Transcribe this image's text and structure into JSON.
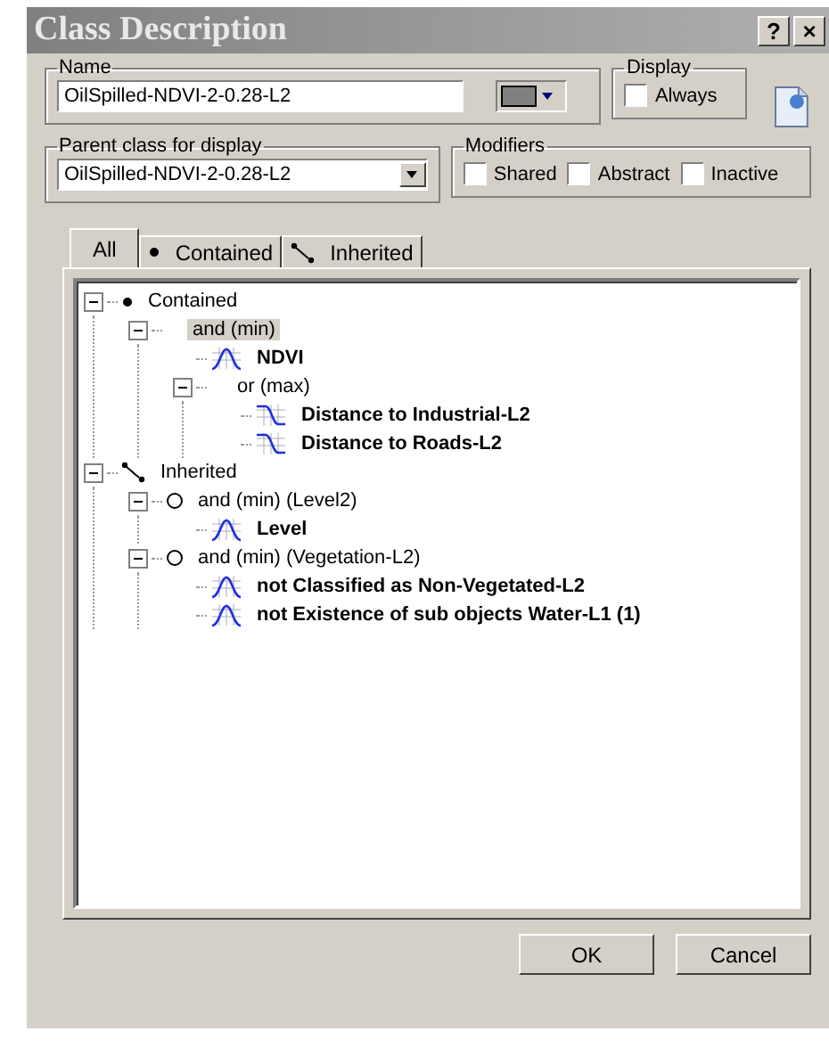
{
  "window": {
    "title": "Class Description",
    "help": "?",
    "close": "×"
  },
  "name_group": {
    "label": "Name",
    "value": "OilSpilled-NDVI-2-0.28-L2"
  },
  "display_group": {
    "label": "Display",
    "options": [
      {
        "label": "Always",
        "checked": false
      }
    ]
  },
  "parent_group": {
    "label": "Parent class for display",
    "value": "OilSpilled-NDVI-2-0.28-L2"
  },
  "modifiers_group": {
    "label": "Modifiers",
    "options": [
      {
        "label": "Shared",
        "checked": false
      },
      {
        "label": "Abstract",
        "checked": false
      },
      {
        "label": "Inactive",
        "checked": false
      }
    ]
  },
  "tabs": [
    {
      "label": "All",
      "kind": "all",
      "selected": true
    },
    {
      "label": "Contained",
      "kind": "contained",
      "selected": false
    },
    {
      "label": "Inherited",
      "kind": "inherited",
      "selected": false
    }
  ],
  "tree": [
    {
      "label": "Contained",
      "kind": "contained",
      "selected": false,
      "expanded": true,
      "children": [
        {
          "label": "and (min)",
          "kind": "operator",
          "selected": true,
          "expanded": true,
          "children": [
            {
              "label": "NDVI",
              "kind": "bell",
              "selected": false
            },
            {
              "label": "or (max)",
              "kind": "operator",
              "selected": false,
              "expanded": true,
              "children": [
                {
                  "label": "Distance to Industrial-L2",
                  "kind": "falling",
                  "selected": false
                },
                {
                  "label": "Distance to Roads-L2",
                  "kind": "falling",
                  "selected": false
                }
              ]
            }
          ]
        }
      ]
    },
    {
      "label": "Inherited",
      "kind": "inherited",
      "selected": false,
      "expanded": true,
      "children": [
        {
          "label": "and (min) (Level2)",
          "kind": "parent-operator",
          "selected": false,
          "expanded": true,
          "children": [
            {
              "label": "Level",
              "kind": "bell",
              "selected": false
            }
          ]
        },
        {
          "label": "and (min) (Vegetation-L2)",
          "kind": "parent-operator",
          "selected": false,
          "expanded": true,
          "children": [
            {
              "label": "not Classified as Non-Vegetated-L2",
              "kind": "bell",
              "selected": false
            },
            {
              "label": "not Existence of sub objects Water-L1 (1)",
              "kind": "bell",
              "selected": false
            }
          ]
        }
      ]
    }
  ],
  "buttons": [
    "OK",
    "Cancel"
  ]
}
